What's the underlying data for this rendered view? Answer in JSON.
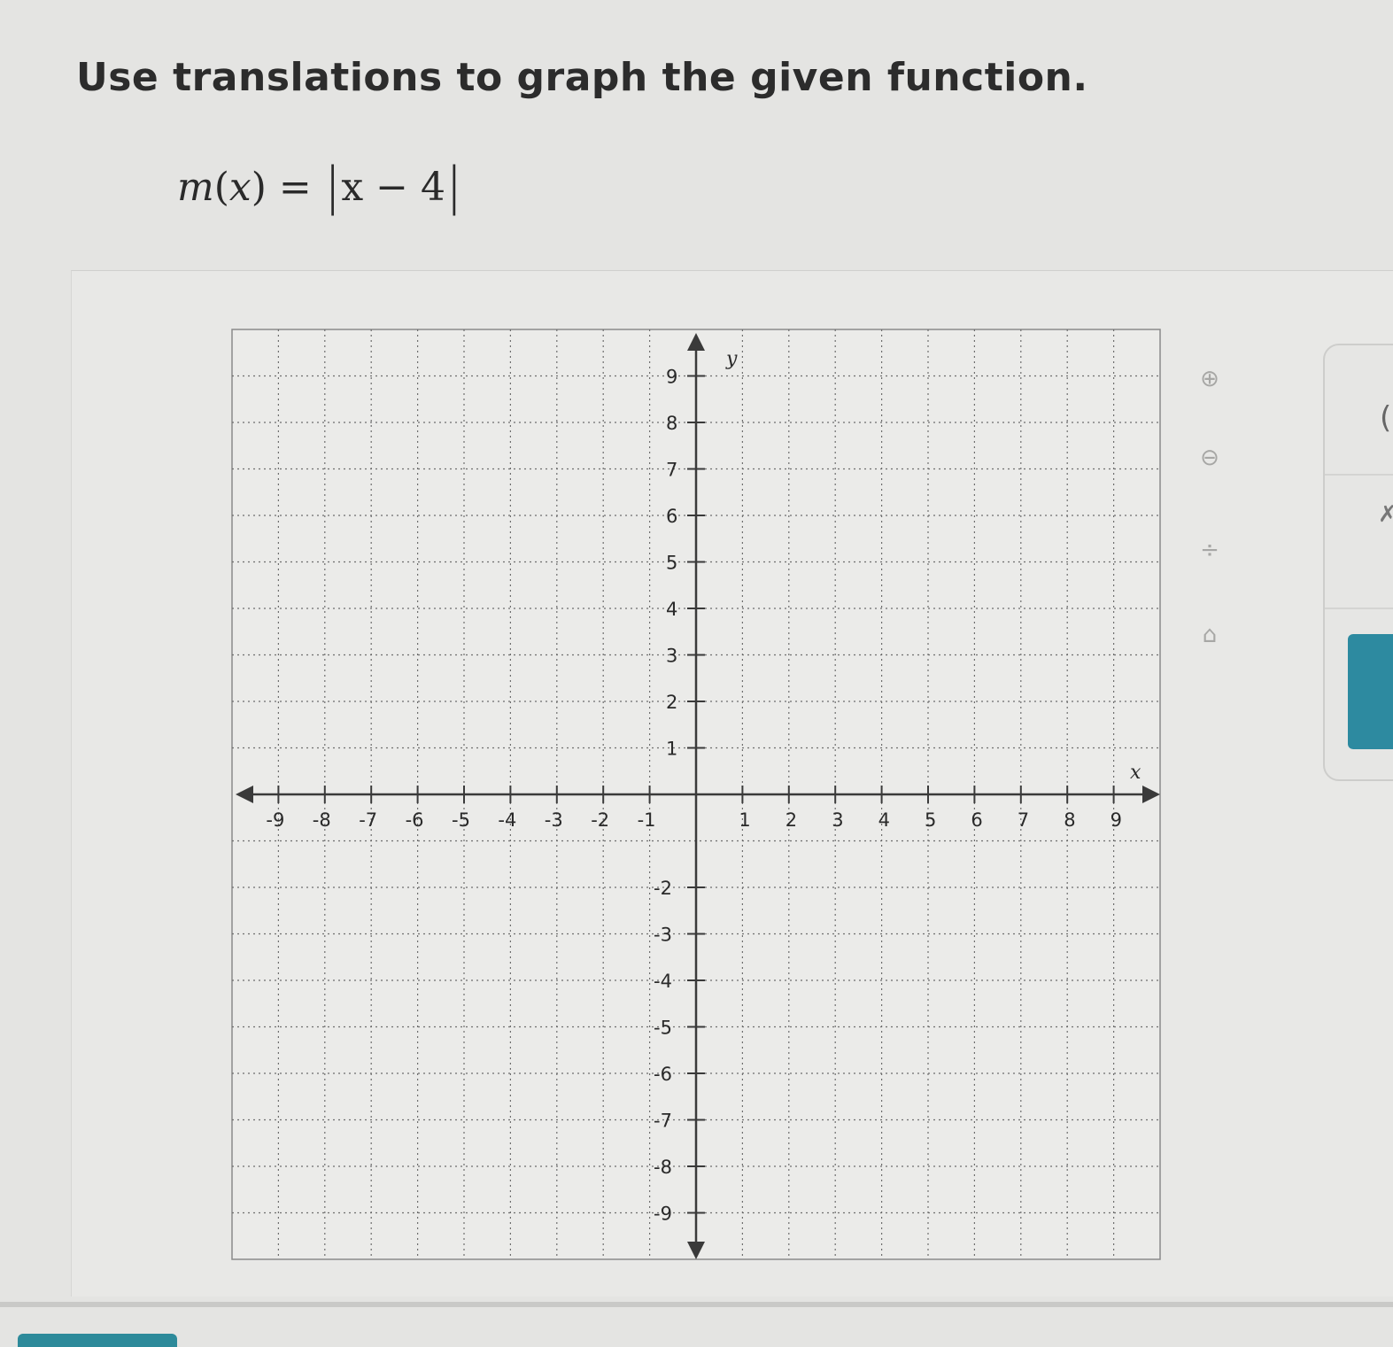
{
  "question": {
    "prompt": "Use translations to graph the given function.",
    "formula_name": "m",
    "formula_lparen": "(",
    "formula_var": "x",
    "formula_rparen": ")",
    "formula_eq": "=",
    "formula_expr": "x − 4"
  },
  "tools": [
    {
      "name": "zoom-in-icon",
      "glyph": "⊕"
    },
    {
      "name": "zoom-out-icon",
      "glyph": "⊖"
    },
    {
      "name": "resize-icon",
      "glyph": "÷"
    },
    {
      "name": "home-icon",
      "glyph": "⌂"
    }
  ],
  "side_panel": {
    "bracket_glyph": "(",
    "mark_glyph": "✗"
  },
  "chart_data": {
    "type": "scatter",
    "xlim": [
      -10,
      10
    ],
    "ylim": [
      -10,
      10
    ],
    "x_ticks": [
      -9,
      -8,
      -7,
      -6,
      -5,
      -4,
      -3,
      -2,
      -1,
      1,
      2,
      3,
      4,
      5,
      6,
      7,
      8,
      9
    ],
    "y_ticks": [
      9,
      8,
      7,
      6,
      5,
      4,
      3,
      2,
      1,
      -2,
      -3,
      -4,
      -5,
      -6,
      -7,
      -8,
      -9
    ],
    "x_tick_labels": [
      "-9",
      "-8",
      "-7",
      "-6",
      "-5",
      "-4",
      "-3",
      "-2",
      "-1",
      "1",
      "2",
      "3",
      "4",
      "5",
      "6",
      "7",
      "8",
      "9"
    ],
    "y_tick_labels": [
      "9",
      "8",
      "7",
      "6",
      "5",
      "4",
      "3",
      "2",
      "1",
      "-2",
      "-3",
      "-4",
      "-5",
      "-6",
      "-7",
      "-8",
      "-9"
    ],
    "xlabel": "x",
    "ylabel": "y",
    "grid": true,
    "series": []
  },
  "colors": {
    "grid": "#6e6e6e",
    "axis": "#3a3a3a",
    "panel_bg": "#e9e9e7",
    "accent": "#2d8aa0"
  }
}
